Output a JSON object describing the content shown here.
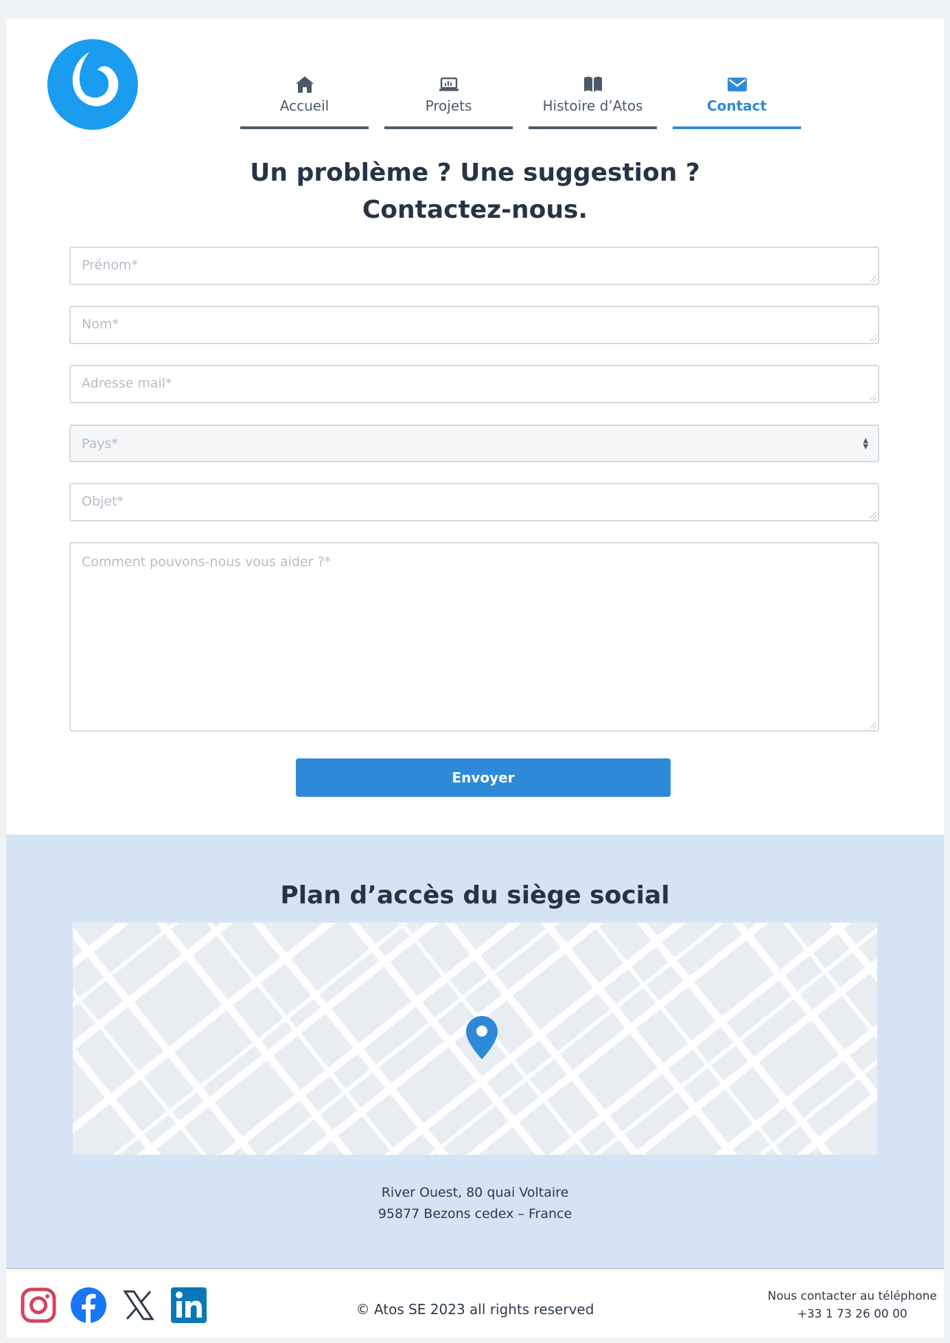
{
  "nav": {
    "items": [
      {
        "label": "Accueil",
        "icon": "home-icon"
      },
      {
        "label": "Projets",
        "icon": "laptop-chart-icon"
      },
      {
        "label": "Histoire d’Atos",
        "icon": "book-icon"
      },
      {
        "label": "Contact",
        "icon": "envelope-icon",
        "active": true
      }
    ]
  },
  "form": {
    "heading_line1": "Un problème ? Une suggestion ?",
    "heading_line2": "Contactez-nous.",
    "firstname_placeholder": "Prénom*",
    "lastname_placeholder": "Nom*",
    "email_placeholder": "Adresse mail*",
    "country_placeholder": "Pays*",
    "subject_placeholder": "Objet*",
    "message_placeholder": "Comment pouvons-nous vous aider ?*",
    "submit_label": "Envoyer"
  },
  "map": {
    "title": "Plan d’accès du siège social",
    "address_line1": "River Ouest, 80 quai Voltaire",
    "address_line2": "95877 Bezons cedex – France"
  },
  "footer": {
    "socials": [
      "instagram-icon",
      "facebook-icon",
      "x-icon",
      "linkedin-icon"
    ],
    "copyright": "© Atos SE 2023 all rights reserved",
    "phone_label": "Nous contacter au téléphone",
    "phone_number": "+33 1 73 26 00 00"
  },
  "colors": {
    "accent": "#2e8ad9",
    "logo": "#1a9cf0",
    "map_band": "#d4e4f4",
    "text_dark": "#263545"
  }
}
